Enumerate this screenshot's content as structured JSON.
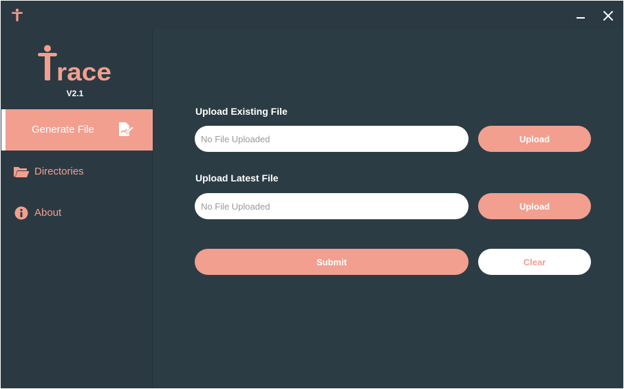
{
  "app": {
    "logo_text": "Trace",
    "version": "V2.1"
  },
  "titlebar": {
    "app_icon": "trace-figure-icon",
    "minimize_icon": "minimize-icon",
    "close_icon": "close-icon"
  },
  "sidebar": {
    "items": [
      {
        "label": "Generate File",
        "icon": "file-edit-icon",
        "active": true
      },
      {
        "label": "Directories",
        "icon": "folder-open-icon",
        "active": false
      },
      {
        "label": "About",
        "icon": "info-icon",
        "active": false
      }
    ]
  },
  "main": {
    "existing": {
      "label": "Upload Existing File",
      "placeholder": "No File Uploaded",
      "button": "Upload"
    },
    "latest": {
      "label": "Upload Latest File",
      "placeholder": "No File Uploaded",
      "button": "Upload"
    },
    "submit_label": "Submit",
    "clear_label": "Clear"
  },
  "colors": {
    "accent": "#f29f8f",
    "background": "#2b3a42",
    "text": "#ffffff"
  }
}
